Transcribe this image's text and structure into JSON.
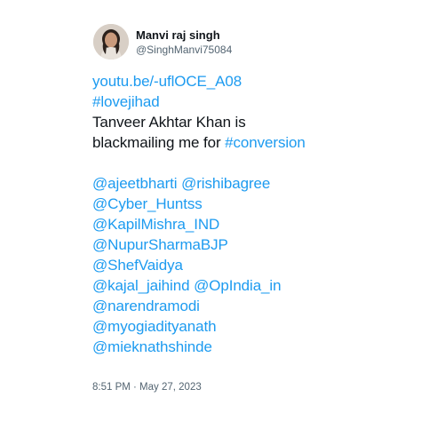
{
  "author": {
    "display_name": "Manvi raj singh",
    "handle": "@SinghManvi75084",
    "avatar_icon": "profile-photo"
  },
  "tweet": {
    "link": "youtu.be/-uflOCE_A08",
    "hashtag_line": "#lovejihad",
    "text_line_1": "Tanveer Akhtar Khan is",
    "text_line_2_prefix": "blackmailing me for ",
    "text_line_2_hashtag": "#conversion",
    "mentions": [
      "@ajeetbharti",
      "@rishibagree",
      "@Cyber_Huntss",
      "@KapilMishra_IND",
      "@NupurSharmaBJP",
      "@ShefVaidya",
      "@kajal_jaihind",
      "@OpIndia_in",
      "@narendramodi",
      "@myogiadityanath",
      "@mieknathshinde"
    ]
  },
  "timestamp": "8:51 PM · May 27, 2023",
  "colors": {
    "link": "#1d9bf0",
    "text": "#0f1419",
    "muted": "#536471"
  }
}
